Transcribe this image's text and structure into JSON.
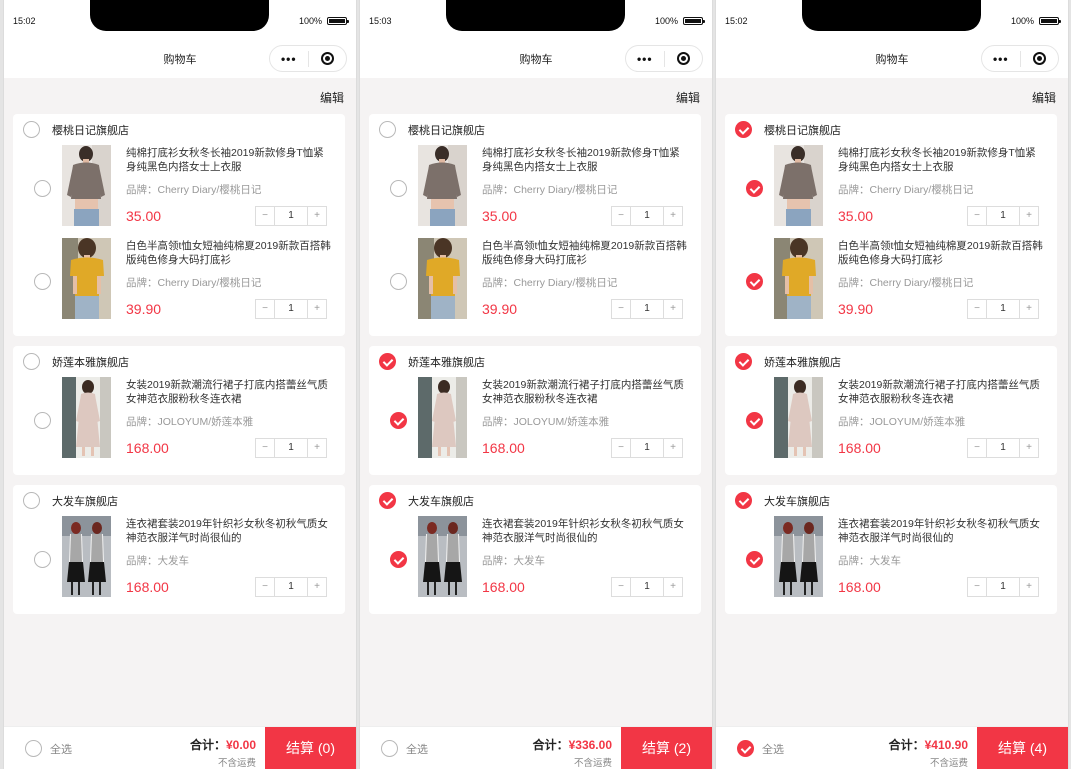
{
  "colors": {
    "accent": "#f23645",
    "background": "#f5f3f3"
  },
  "screens": [
    {
      "time": "15:02",
      "battery": "100%",
      "title": "购物车",
      "edit": "编辑",
      "capsule_more": "•••",
      "shops": [
        {
          "name": "樱桃日记旗舰店",
          "checked": false,
          "items": [
            {
              "name": "纯棉打底衫女秋冬长袖2019新款修身T恤紧身纯黑色内搭女士上衣服",
              "brand": "品牌：Cherry Diary/樱桃日记",
              "price": "35.00",
              "qty": "1",
              "checked": false,
              "image": "grey-top"
            },
            {
              "name": "白色半高领t恤女短袖纯棉夏2019新款百搭韩版纯色修身大码打底衫",
              "brand": "品牌：Cherry Diary/樱桃日记",
              "price": "39.90",
              "qty": "1",
              "checked": false,
              "image": "yellow-tee"
            }
          ]
        },
        {
          "name": "娇莲本雅旗舰店",
          "checked": false,
          "items": [
            {
              "name": "女装2019新款潮流行裙子打底内搭蕾丝气质女神范衣服粉秋冬连衣裙",
              "brand": "品牌：JOLOYUM/娇莲本雅",
              "price": "168.00",
              "qty": "1",
              "checked": false,
              "image": "pink-dress"
            }
          ]
        },
        {
          "name": "大发车旗舰店",
          "checked": false,
          "items": [
            {
              "name": "连衣裙套装2019年针织衫女秋冬初秋气质女神范衣服洋气时尚很仙的",
              "brand": "品牌：大发车",
              "price": "168.00",
              "qty": "1",
              "checked": false,
              "image": "knit-set"
            }
          ]
        }
      ],
      "select_all_label": "全选",
      "select_all": false,
      "total_label": "合计：",
      "total": "¥0.00",
      "shipping_note": "不含运费",
      "checkout_label": "结算 (0)"
    },
    {
      "time": "15:03",
      "battery": "100%",
      "title": "购物车",
      "edit": "编辑",
      "capsule_more": "•••",
      "shops": [
        {
          "name": "樱桃日记旗舰店",
          "checked": false,
          "items": [
            {
              "name": "纯棉打底衫女秋冬长袖2019新款修身T恤紧身纯黑色内搭女士上衣服",
              "brand": "品牌：Cherry Diary/樱桃日记",
              "price": "35.00",
              "qty": "1",
              "checked": false,
              "image": "grey-top"
            },
            {
              "name": "白色半高领t恤女短袖纯棉夏2019新款百搭韩版纯色修身大码打底衫",
              "brand": "品牌：Cherry Diary/樱桃日记",
              "price": "39.90",
              "qty": "1",
              "checked": false,
              "image": "yellow-tee"
            }
          ]
        },
        {
          "name": "娇莲本雅旗舰店",
          "checked": true,
          "items": [
            {
              "name": "女装2019新款潮流行裙子打底内搭蕾丝气质女神范衣服粉秋冬连衣裙",
              "brand": "品牌：JOLOYUM/娇莲本雅",
              "price": "168.00",
              "qty": "1",
              "checked": true,
              "image": "pink-dress"
            }
          ]
        },
        {
          "name": "大发车旗舰店",
          "checked": true,
          "items": [
            {
              "name": "连衣裙套装2019年针织衫女秋冬初秋气质女神范衣服洋气时尚很仙的",
              "brand": "品牌：大发车",
              "price": "168.00",
              "qty": "1",
              "checked": true,
              "image": "knit-set"
            }
          ]
        }
      ],
      "select_all_label": "全选",
      "select_all": false,
      "total_label": "合计：",
      "total": "¥336.00",
      "shipping_note": "不含运费",
      "checkout_label": "结算 (2)"
    },
    {
      "time": "15:02",
      "battery": "100%",
      "title": "购物车",
      "edit": "编辑",
      "capsule_more": "•••",
      "shops": [
        {
          "name": "樱桃日记旗舰店",
          "checked": true,
          "items": [
            {
              "name": "纯棉打底衫女秋冬长袖2019新款修身T恤紧身纯黑色内搭女士上衣服",
              "brand": "品牌：Cherry Diary/樱桃日记",
              "price": "35.00",
              "qty": "1",
              "checked": true,
              "image": "grey-top"
            },
            {
              "name": "白色半高领t恤女短袖纯棉夏2019新款百搭韩版纯色修身大码打底衫",
              "brand": "品牌：Cherry Diary/樱桃日记",
              "price": "39.90",
              "qty": "1",
              "checked": true,
              "image": "yellow-tee"
            }
          ]
        },
        {
          "name": "娇莲本雅旗舰店",
          "checked": true,
          "items": [
            {
              "name": "女装2019新款潮流行裙子打底内搭蕾丝气质女神范衣服粉秋冬连衣裙",
              "brand": "品牌：JOLOYUM/娇莲本雅",
              "price": "168.00",
              "qty": "1",
              "checked": true,
              "image": "pink-dress"
            }
          ]
        },
        {
          "name": "大发车旗舰店",
          "checked": true,
          "items": [
            {
              "name": "连衣裙套装2019年针织衫女秋冬初秋气质女神范衣服洋气时尚很仙的",
              "brand": "品牌：大发车",
              "price": "168.00",
              "qty": "1",
              "checked": true,
              "image": "knit-set"
            }
          ]
        }
      ],
      "select_all_label": "全选",
      "select_all": true,
      "total_label": "合计：",
      "total": "¥410.90",
      "shipping_note": "不含运费",
      "checkout_label": "结算 (4)"
    }
  ]
}
